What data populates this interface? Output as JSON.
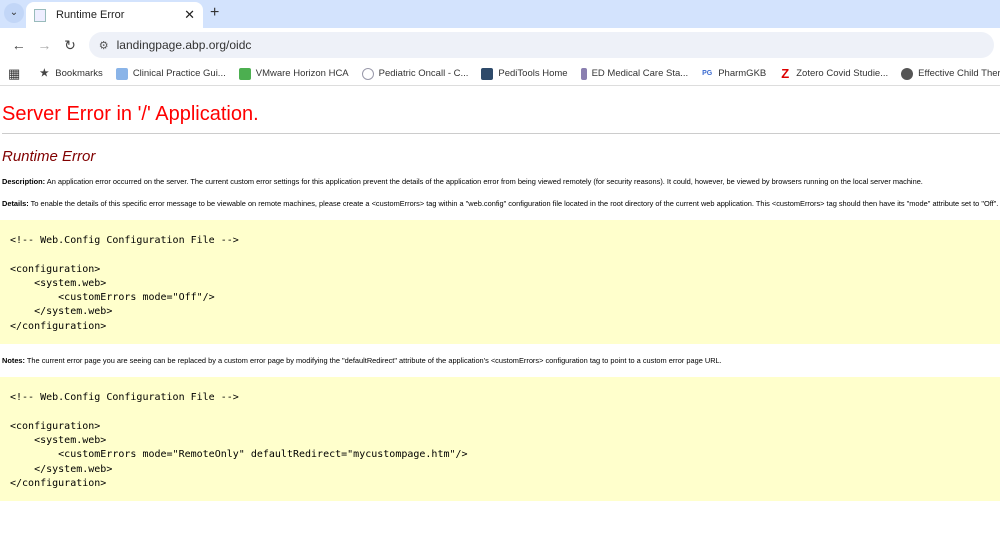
{
  "browser": {
    "tab_title": "Runtime Error",
    "url": "landingpage.abp.org/oidc",
    "bookmarks": [
      {
        "label": "Bookmarks",
        "icon": "star-icon"
      },
      {
        "label": "Clinical Practice Gui...",
        "icon": "clinical-icon"
      },
      {
        "label": "VMware Horizon HCA",
        "icon": "vmware-icon"
      },
      {
        "label": "Pediatric Oncall - C...",
        "icon": "oncall-icon"
      },
      {
        "label": "PediTools Home",
        "icon": "peditools-icon"
      },
      {
        "label": "ED Medical Care Sta...",
        "icon": "ed-icon"
      },
      {
        "label": "PharmGKB",
        "icon": "pharmgkb-icon"
      },
      {
        "label": "Zotero Covid Studie...",
        "icon": "zotero-icon"
      },
      {
        "label": "Effective Child Ther...",
        "icon": "globe-icon"
      }
    ]
  },
  "page": {
    "title": "Server Error in '/' Application.",
    "subtitle": "Runtime Error",
    "description_label": "Description:",
    "description": " An application error occurred on the server. The current custom error settings for this application prevent the details of the application error from being viewed remotely (for security reasons). It could, however, be viewed by browsers running on the local server machine.",
    "details_label": "Details:",
    "details": " To enable the details of this specific error message to be viewable on remote machines, please create a <customErrors> tag within a \"web.config\" configuration file located in the root directory of the current web application. This <customErrors> tag should then have its \"mode\" attribute set to \"Off\".",
    "code1": "<!-- Web.Config Configuration File -->\n\n<configuration>\n    <system.web>\n        <customErrors mode=\"Off\"/>\n    </system.web>\n</configuration>",
    "notes_label": "Notes:",
    "notes": " The current error page you are seeing can be replaced by a custom error page by modifying the \"defaultRedirect\" attribute of the application's <customErrors> configuration tag to point to a custom error page URL.",
    "code2": "<!-- Web.Config Configuration File -->\n\n<configuration>\n    <system.web>\n        <customErrors mode=\"RemoteOnly\" defaultRedirect=\"mycustompage.htm\"/>\n    </system.web>\n</configuration>"
  }
}
